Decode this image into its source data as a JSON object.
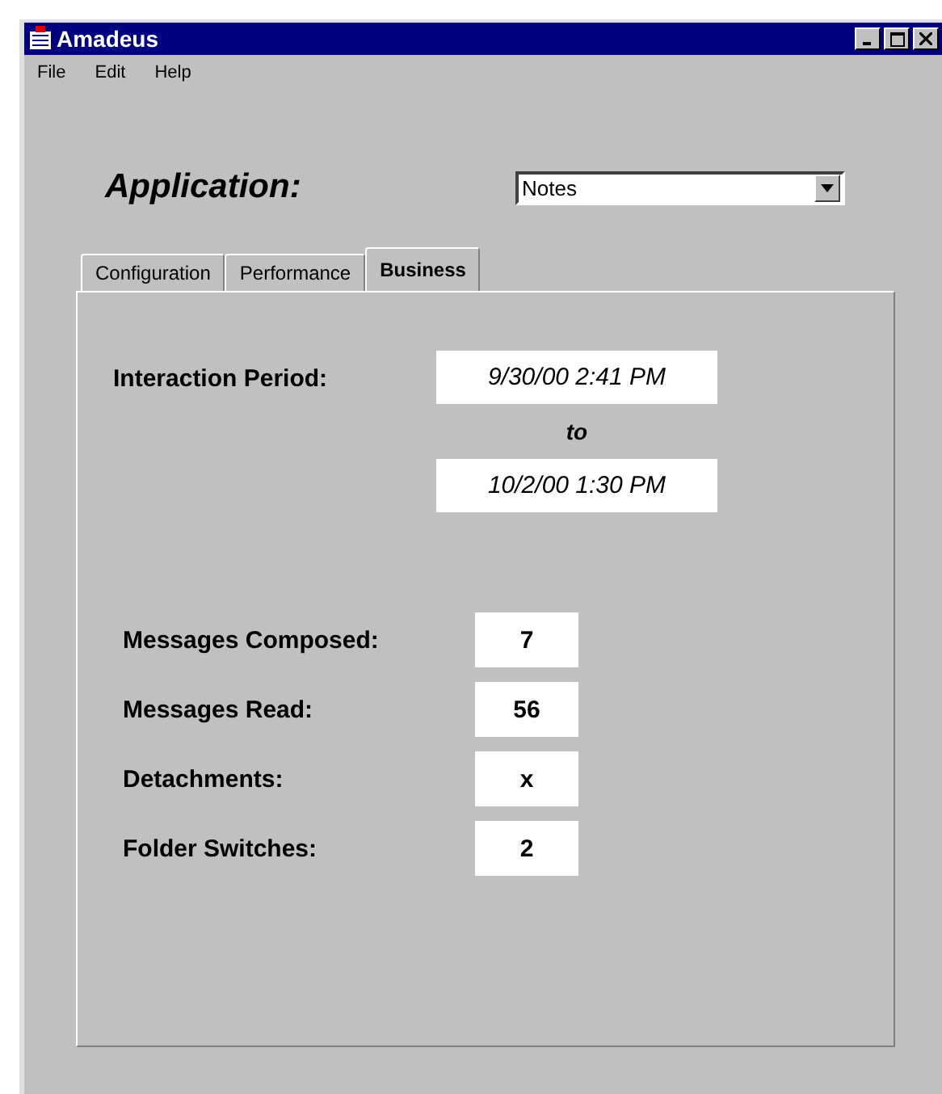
{
  "window": {
    "title": "Amadeus"
  },
  "menu": [
    "File",
    "Edit",
    "Help"
  ],
  "application": {
    "label": "Application:",
    "value": "Notes"
  },
  "tabs": [
    {
      "label": "Configuration",
      "selected": false
    },
    {
      "label": "Performance",
      "selected": false
    },
    {
      "label": "Business",
      "selected": true
    }
  ],
  "interaction_period": {
    "label": "Interaction Period:",
    "start": "9/30/00 2:41 PM",
    "separator": "to",
    "end": "10/2/00 1:30 PM"
  },
  "stats": [
    {
      "label": "Messages Composed:",
      "value": "7"
    },
    {
      "label": "Messages Read:",
      "value": "56"
    },
    {
      "label": "Detachments:",
      "value": "x"
    },
    {
      "label": "Folder Switches:",
      "value": "2"
    }
  ]
}
